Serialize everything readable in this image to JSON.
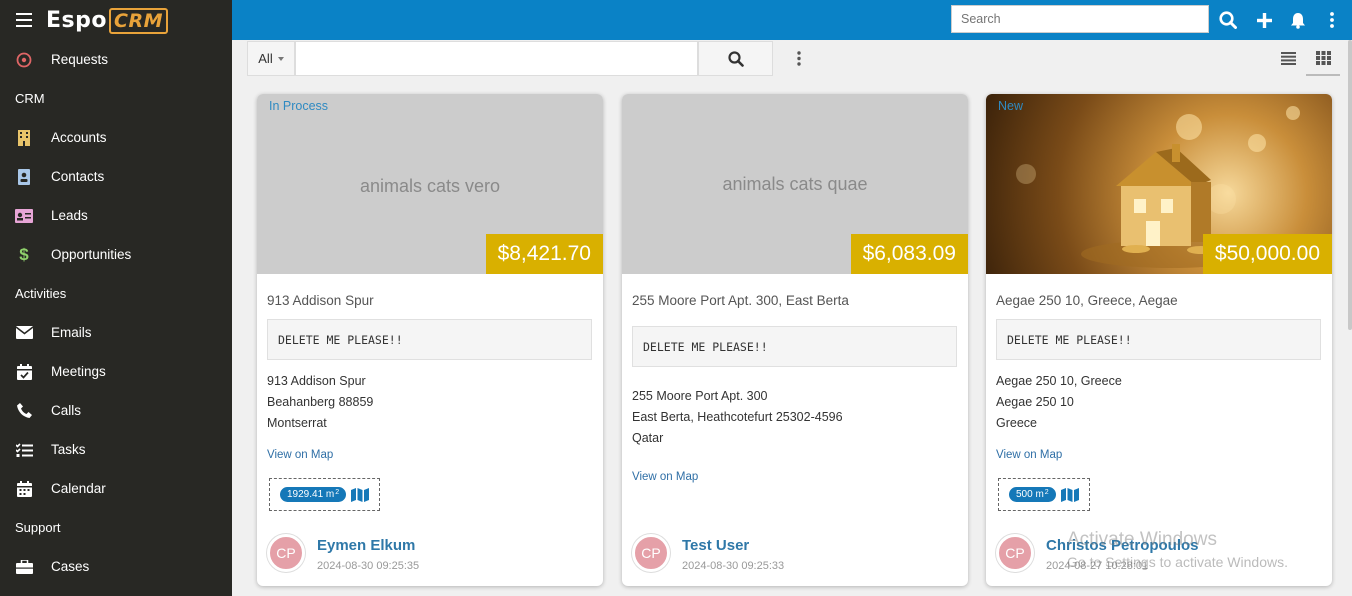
{
  "app": {
    "logo_main": "Espo",
    "logo_crm": "CRM"
  },
  "sidebar": {
    "items": [
      {
        "type": "item",
        "label": "Requests",
        "icon": "target-icon",
        "color": "#e06666"
      },
      {
        "type": "group",
        "label": "CRM"
      },
      {
        "type": "item",
        "label": "Accounts",
        "icon": "building-icon",
        "color": "#e8c46a"
      },
      {
        "type": "item",
        "label": "Contacts",
        "icon": "contact-card-icon",
        "color": "#a9c7e8"
      },
      {
        "type": "item",
        "label": "Leads",
        "icon": "id-card-icon",
        "color": "#e7a5d6"
      },
      {
        "type": "item",
        "label": "Opportunities",
        "icon": "dollar-icon",
        "color": "#8fd16b"
      },
      {
        "type": "group",
        "label": "Activities"
      },
      {
        "type": "item",
        "label": "Emails",
        "icon": "envelope-icon",
        "color": "#ffffff"
      },
      {
        "type": "item",
        "label": "Meetings",
        "icon": "calendar-check-icon",
        "color": "#ffffff"
      },
      {
        "type": "item",
        "label": "Calls",
        "icon": "phone-icon",
        "color": "#ffffff"
      },
      {
        "type": "item",
        "label": "Tasks",
        "icon": "tasks-icon",
        "color": "#ffffff"
      },
      {
        "type": "item",
        "label": "Calendar",
        "icon": "calendar-icon",
        "color": "#ffffff"
      },
      {
        "type": "group",
        "label": "Support"
      },
      {
        "type": "item",
        "label": "Cases",
        "icon": "briefcase-icon",
        "color": "#ffffff"
      }
    ]
  },
  "topbar": {
    "search_placeholder": "Search"
  },
  "list": {
    "filter_label": "All"
  },
  "cards": [
    {
      "status": "In Process",
      "image_text": "animals cats vero",
      "price": "$8,421.70",
      "title": "913 Addison Spur",
      "code": "DELETE ME PLEASE!!",
      "address": [
        "913 Addison Spur",
        "Beahanberg 88859",
        "Montserrat"
      ],
      "map_link": "View on Map",
      "area": "1929.41 m",
      "area_unit_sup": "2",
      "avatar": "CP",
      "user": "Eymen Elkum",
      "date": "2024-08-30 09:25:35"
    },
    {
      "status": "",
      "image_text": "animals cats quae",
      "price": "$6,083.09",
      "title": "255 Moore Port Apt. 300, East Berta",
      "code": "DELETE ME PLEASE!!",
      "address": [
        "255 Moore Port Apt. 300",
        "East Berta, Heathcotefurt 25302-4596",
        "Qatar"
      ],
      "map_link": "View on Map",
      "avatar": "CP",
      "user": "Test User",
      "date": "2024-08-30 09:25:33"
    },
    {
      "status": "New",
      "image_text": "",
      "price": "$50,000.00",
      "title": "Aegae 250 10, Greece, Aegae",
      "code": "DELETE ME PLEASE!!",
      "address": [
        "Aegae 250 10, Greece",
        "Aegae 250 10",
        "Greece"
      ],
      "map_link": "View on Map",
      "area": "500 m",
      "area_unit_sup": "2",
      "avatar": "CP",
      "user": "Christos Petropoulos",
      "date": "2024-08-27 10:28:01"
    }
  ],
  "watermark": {
    "title": "Activate Windows",
    "subtitle": "Go to Settings to activate Windows."
  }
}
